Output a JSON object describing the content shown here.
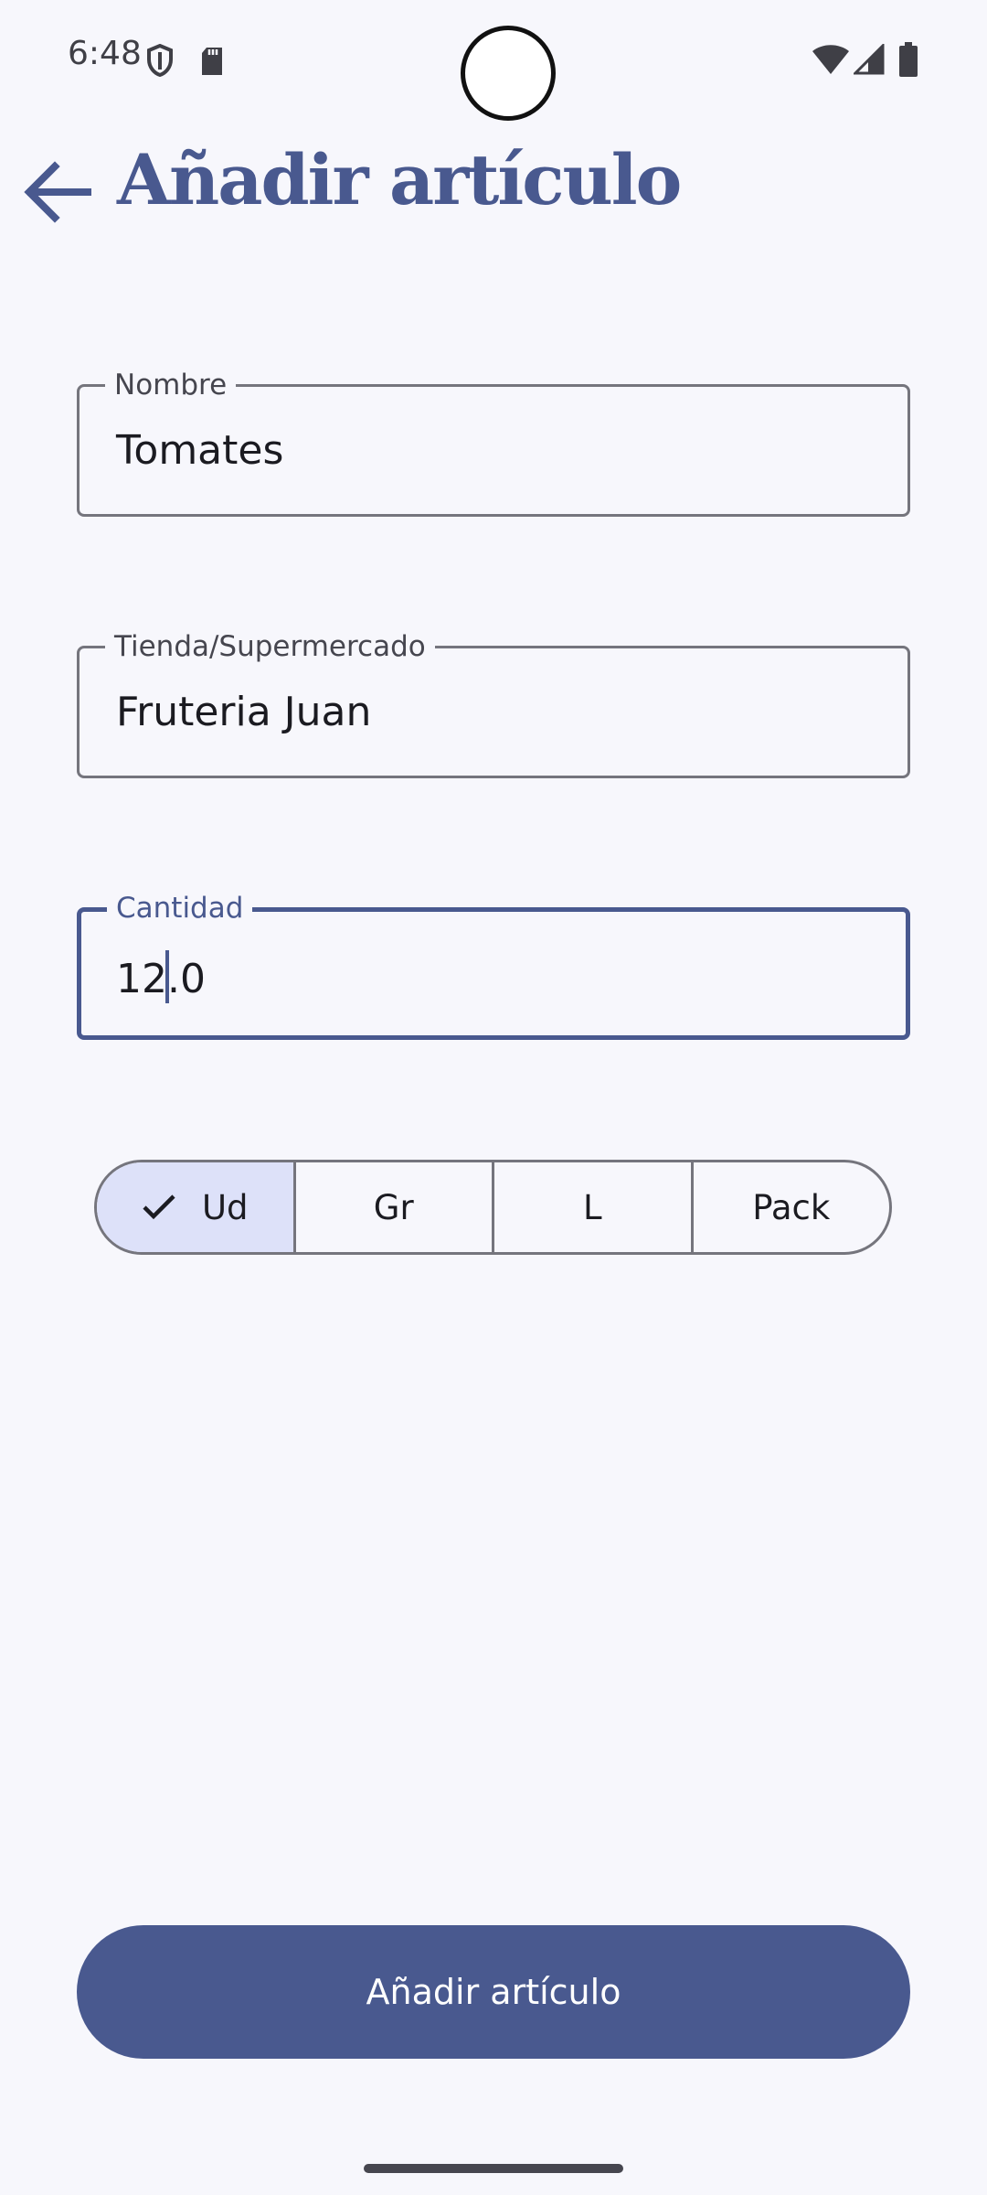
{
  "status_bar": {
    "time": "6:48",
    "icons": [
      "shield-icon",
      "sdcard-icon",
      "wifi-icon",
      "signal-icon",
      "battery-icon"
    ]
  },
  "header": {
    "back_icon": "arrow-left-icon",
    "title": "Añadir artículo"
  },
  "form": {
    "nombre": {
      "label": "Nombre",
      "value": "Tomates"
    },
    "tienda": {
      "label": "Tienda/Supermercado",
      "value": "Fruteria Juan"
    },
    "cantidad": {
      "label": "Cantidad",
      "value_before_cursor": "12",
      "value_after_cursor": ".0"
    }
  },
  "units": {
    "selected": "Ud",
    "options": [
      "Ud",
      "Gr",
      "L",
      "Pack"
    ]
  },
  "submit_label": "Añadir artículo",
  "colors": {
    "accent": "#49598f",
    "selected_segment": "#dde1f9",
    "outline": "#75757d",
    "background": "#f7f7fc"
  }
}
